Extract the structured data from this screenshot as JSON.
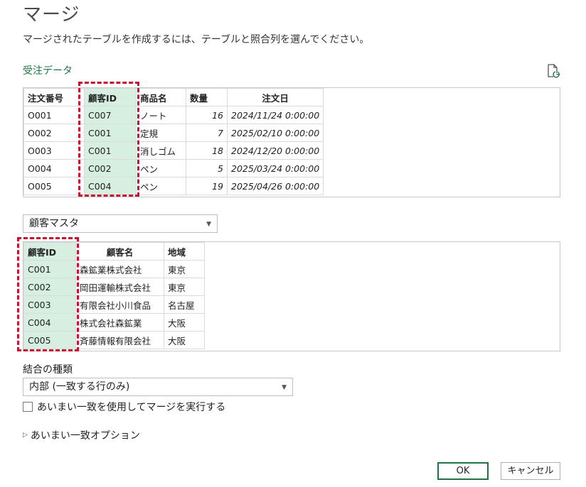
{
  "dialog": {
    "title": "マージ",
    "description": "マージされたテーブルを作成するには、テーブルと照合列を選んでください。"
  },
  "table1": {
    "name": "受注データ",
    "columns": [
      "注文番号",
      "顧客ID",
      "商品名",
      "数量",
      "注文日"
    ],
    "rows": [
      [
        "O001",
        "C007",
        "ノート",
        "16",
        "2024/11/24 0:00:00"
      ],
      [
        "O002",
        "C001",
        "定規",
        "7",
        "2025/02/10 0:00:00"
      ],
      [
        "O003",
        "C001",
        "消しゴム",
        "18",
        "2024/12/20 0:00:00"
      ],
      [
        "O004",
        "C002",
        "ペン",
        "5",
        "2025/03/24 0:00:00"
      ],
      [
        "O005",
        "C004",
        "ペン",
        "19",
        "2025/04/26 0:00:00"
      ]
    ]
  },
  "table2": {
    "dropdown_value": "顧客マスタ",
    "columns": [
      "顧客ID",
      "顧客名",
      "地域"
    ],
    "rows": [
      [
        "C001",
        "森鉱業株式会社",
        "東京"
      ],
      [
        "C002",
        "岡田運輸株式会社",
        "東京"
      ],
      [
        "C003",
        "有限会社小川食品",
        "名古屋"
      ],
      [
        "C004",
        "株式会社森鉱業",
        "大阪"
      ],
      [
        "C005",
        "斉藤情報有限会社",
        "大阪"
      ]
    ]
  },
  "join": {
    "label": "結合の種類",
    "value": "内部 (一致する行のみ)"
  },
  "fuzzy": {
    "checkbox_label": "あいまい一致を使用してマージを実行する",
    "checked": false,
    "options_label": "あいまい一致オプション"
  },
  "buttons": {
    "ok": "OK",
    "cancel": "キャンセル"
  },
  "colors": {
    "accent": "#217346",
    "selected_column": "#d6efe1",
    "highlight_dash": "#c8102e"
  }
}
